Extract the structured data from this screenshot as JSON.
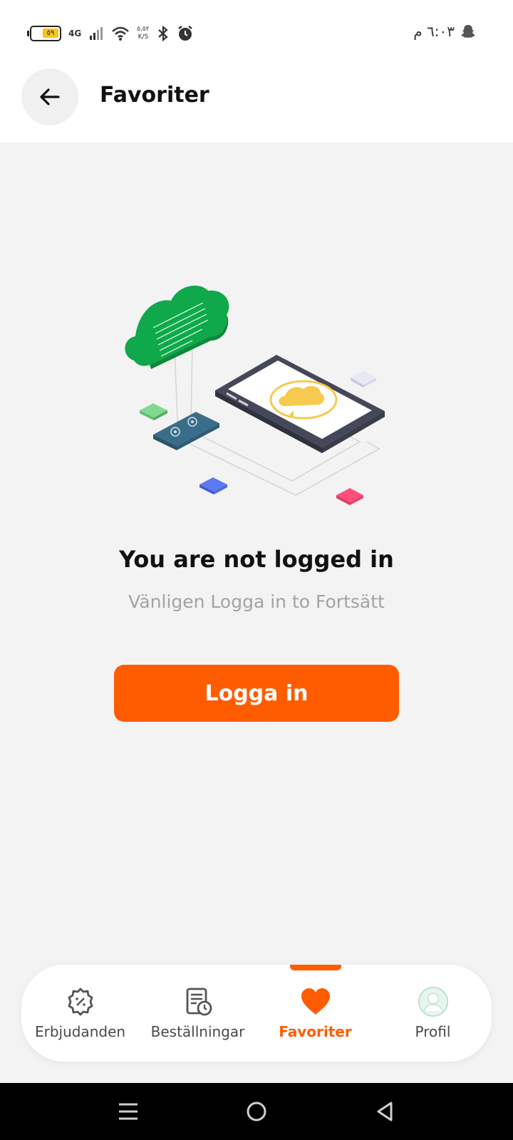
{
  "status_bar": {
    "battery_level": "٥٩",
    "network_type": "4G",
    "speed_value": "٥,٥٢",
    "speed_unit": "K/S",
    "time": "٦:٠٣ م"
  },
  "header": {
    "title": "Favoriter"
  },
  "empty_state": {
    "title": "You are not logged in",
    "subtitle": "Vänligen Logga in to Fortsätt",
    "button_label": "Logga in"
  },
  "bottom_nav": {
    "items": [
      {
        "label": "Erbjudanden",
        "icon": "discount-badge-icon",
        "active": false
      },
      {
        "label": "Beställningar",
        "icon": "orders-clock-icon",
        "active": false
      },
      {
        "label": "Favoriter",
        "icon": "heart-icon",
        "active": true
      },
      {
        "label": "Profil",
        "icon": "avatar-icon",
        "active": false
      }
    ]
  },
  "colors": {
    "accent": "#ff5c00",
    "background": "#f3f3f3",
    "cloud_green": "#0fa84a"
  }
}
